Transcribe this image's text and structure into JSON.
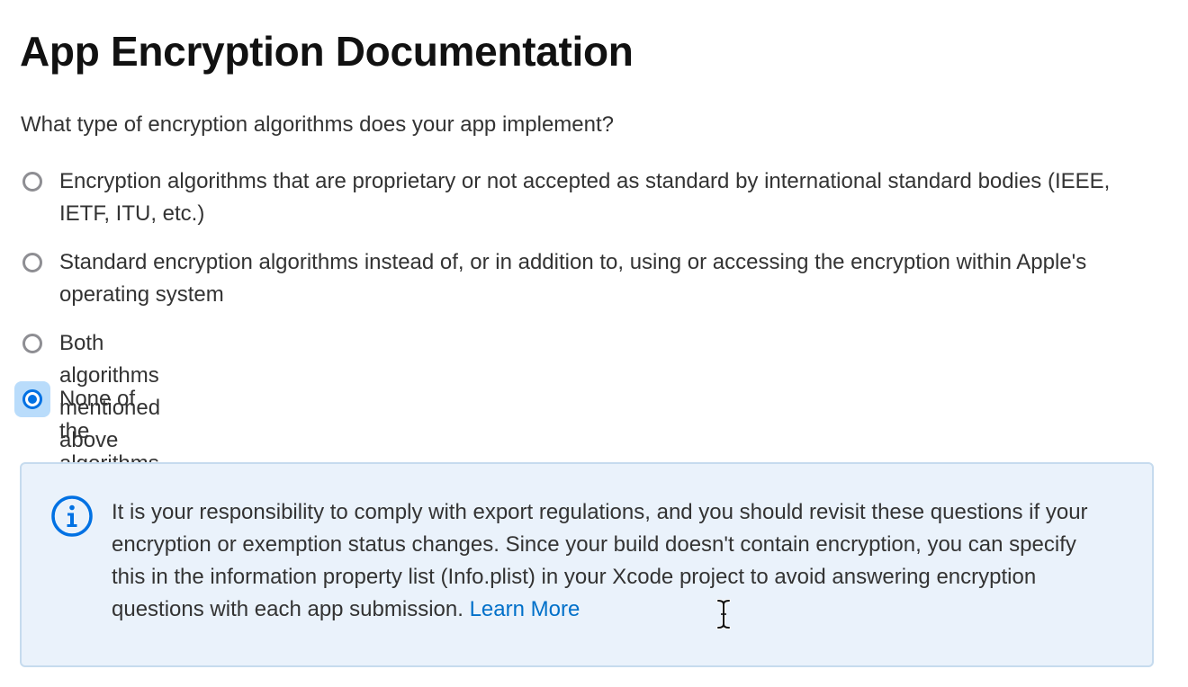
{
  "page": {
    "title": "App Encryption Documentation",
    "question": "What type of encryption algorithms does your app implement?"
  },
  "options": [
    {
      "label": "Encryption algorithms that are proprietary or not accepted as standard by international standard bodies (IEEE, IETF, ITU, etc.)",
      "selected": false
    },
    {
      "label": "Standard encryption algorithms instead of, or in addition to, using or accessing the encryption within Apple's operating system",
      "selected": false
    },
    {
      "label": "Both algorithms mentioned above",
      "selected": false
    },
    {
      "label": "None of the algorithms mentioned above",
      "selected": true
    }
  ],
  "info": {
    "icon": "info-circle-icon",
    "text": "It is your responsibility to comply with export regulations, and you should revisit these questions if your encryption or exemption status changes. Since your build doesn't contain encryption, you can specify this in the information property list (Info.plist) in your Xcode project to avoid answering encryption questions with each app submission.",
    "link_label": "Learn More"
  },
  "colors": {
    "accent": "#0071e3",
    "link": "#0070c9",
    "info_background": "#eaf2fb",
    "info_border": "#c6dbee",
    "radio_unselected": "#8e8e93",
    "selected_highlight": "#b9dcfb"
  },
  "cursor": {
    "type": "text-cursor-icon"
  }
}
